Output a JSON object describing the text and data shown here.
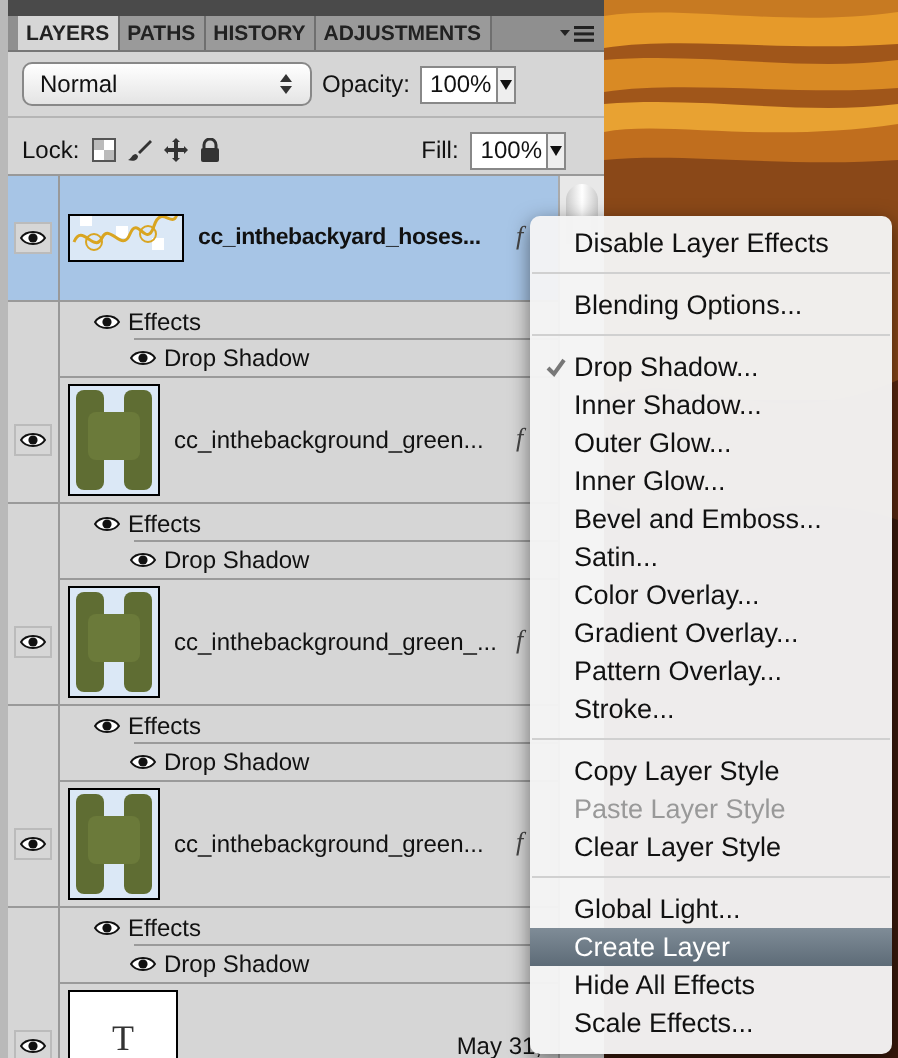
{
  "panel": {
    "tabs": [
      {
        "label": "LAYERS",
        "selected": true
      },
      {
        "label": "PATHS",
        "selected": false
      },
      {
        "label": "HISTORY",
        "selected": false
      },
      {
        "label": "ADJUSTMENTS",
        "selected": false
      }
    ],
    "blend_mode": "Normal",
    "opacity": {
      "label": "Opacity:",
      "value": "100%"
    },
    "lock": {
      "label": "Lock:"
    },
    "fill": {
      "label": "Fill:",
      "value": "100%"
    },
    "layers": [
      {
        "name": "cc_inthebackyard_hoses...",
        "kind": "hose",
        "selected": true,
        "visible": true,
        "fx": "f",
        "effects": {
          "label": "Effects",
          "visible": true,
          "children": [
            {
              "label": "Drop Shadow",
              "visible": true
            }
          ]
        }
      },
      {
        "name": "cc_inthebackground_green...",
        "kind": "letter",
        "selected": false,
        "visible": true,
        "fx": "f",
        "effects": {
          "label": "Effects",
          "visible": true,
          "children": [
            {
              "label": "Drop Shadow",
              "visible": true
            }
          ]
        }
      },
      {
        "name": "cc_inthebackground_green_...",
        "kind": "letter",
        "selected": false,
        "visible": true,
        "fx": "f",
        "effects": {
          "label": "Effects",
          "visible": true,
          "children": [
            {
              "label": "Drop Shadow",
              "visible": true
            }
          ]
        }
      },
      {
        "name": "cc_inthebackground_green...",
        "kind": "letter",
        "selected": false,
        "visible": true,
        "fx": "f",
        "effects": {
          "label": "Effects",
          "visible": true,
          "children": [
            {
              "label": "Drop Shadow",
              "visible": true
            }
          ]
        }
      },
      {
        "name": "May 31,",
        "kind": "text",
        "glyph": "T",
        "selected": false,
        "visible": true
      }
    ]
  },
  "context_menu": {
    "groups": [
      [
        {
          "label": "Disable Layer Effects",
          "checked": false,
          "disabled": false,
          "selected": false
        }
      ],
      [
        {
          "label": "Blending Options...",
          "checked": false,
          "disabled": false,
          "selected": false
        }
      ],
      [
        {
          "label": "Drop Shadow...",
          "checked": true,
          "disabled": false,
          "selected": false
        },
        {
          "label": "Inner Shadow...",
          "checked": false,
          "disabled": false,
          "selected": false
        },
        {
          "label": "Outer Glow...",
          "checked": false,
          "disabled": false,
          "selected": false
        },
        {
          "label": "Inner Glow...",
          "checked": false,
          "disabled": false,
          "selected": false
        },
        {
          "label": "Bevel and Emboss...",
          "checked": false,
          "disabled": false,
          "selected": false
        },
        {
          "label": "Satin...",
          "checked": false,
          "disabled": false,
          "selected": false
        },
        {
          "label": "Color Overlay...",
          "checked": false,
          "disabled": false,
          "selected": false
        },
        {
          "label": "Gradient Overlay...",
          "checked": false,
          "disabled": false,
          "selected": false
        },
        {
          "label": "Pattern Overlay...",
          "checked": false,
          "disabled": false,
          "selected": false
        },
        {
          "label": "Stroke...",
          "checked": false,
          "disabled": false,
          "selected": false
        }
      ],
      [
        {
          "label": "Copy Layer Style",
          "checked": false,
          "disabled": false,
          "selected": false
        },
        {
          "label": "Paste Layer Style",
          "checked": false,
          "disabled": true,
          "selected": false
        },
        {
          "label": "Clear Layer Style",
          "checked": false,
          "disabled": false,
          "selected": false
        }
      ],
      [
        {
          "label": "Global Light...",
          "checked": false,
          "disabled": false,
          "selected": false
        },
        {
          "label": "Create Layer",
          "checked": false,
          "disabled": false,
          "selected": true
        },
        {
          "label": "Hide All Effects",
          "checked": false,
          "disabled": false,
          "selected": false
        },
        {
          "label": "Scale Effects...",
          "checked": false,
          "disabled": false,
          "selected": false
        }
      ]
    ]
  }
}
